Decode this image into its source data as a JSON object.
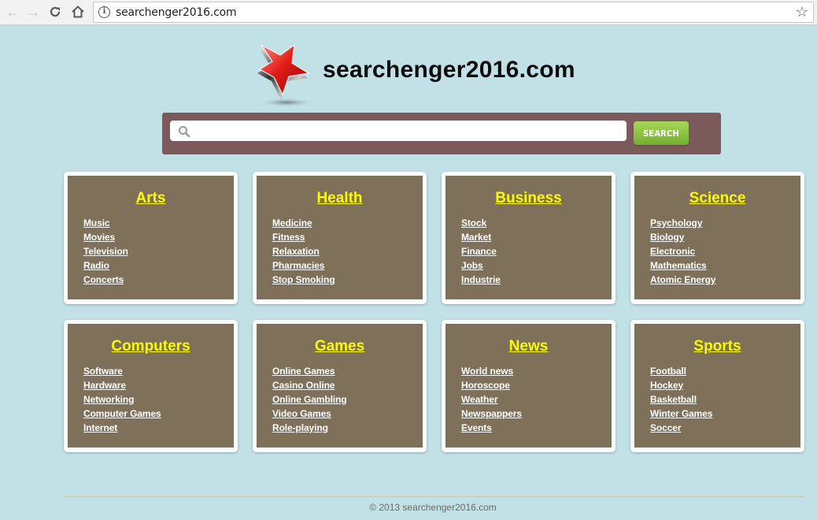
{
  "browser": {
    "back_icon": "arrow-left-icon",
    "forward_icon": "arrow-right-icon",
    "reload_icon": "reload-icon",
    "home_icon": "home-icon",
    "info_icon": "info-icon",
    "bookmark_icon": "star-outline-icon",
    "url": "searchenger2016.com"
  },
  "header": {
    "logo_icon": "red-star-logo",
    "site_title": "searchenger2016.com"
  },
  "search": {
    "placeholder": "",
    "value": "",
    "button_label": "SEARCH",
    "colors": {
      "bar": "#7c595b",
      "button": "#8cc43f"
    }
  },
  "categories": [
    {
      "title": "Arts",
      "links": [
        "Music",
        "Movies",
        "Television",
        "Radio",
        "Concerts"
      ]
    },
    {
      "title": "Health",
      "links": [
        "Medicine",
        "Fitness",
        "Relaxation",
        "Pharmacies",
        "Stop Smoking"
      ]
    },
    {
      "title": "Business",
      "links": [
        "Stock",
        "Market",
        "Finance",
        "Jobs",
        "Industrie"
      ]
    },
    {
      "title": "Science",
      "links": [
        "Psychology",
        "Biology",
        "Electronic",
        "Mathematics",
        "Atomic Energy"
      ]
    },
    {
      "title": "Computers",
      "links": [
        "Software",
        "Hardware",
        "Networking",
        "Computer Games",
        "Internet"
      ]
    },
    {
      "title": "Games",
      "links": [
        "Online Games",
        "Casino Online",
        "Online Gambling",
        "Video Games",
        "Role-playing"
      ]
    },
    {
      "title": "News",
      "links": [
        "World news",
        "Horoscope",
        "Weather",
        "Newspappers",
        "Events"
      ]
    },
    {
      "title": "Sports",
      "links": [
        "Football",
        "Hockey",
        "Basketball",
        "Winter Games",
        "Soccer"
      ]
    }
  ],
  "colors": {
    "page_background": "#c2e1e7",
    "card_background": "#7f7159",
    "card_title": "#fbfb00",
    "card_link": "#ffffff"
  },
  "footer": {
    "copyright": "© 2013 searchenger2016.com"
  }
}
